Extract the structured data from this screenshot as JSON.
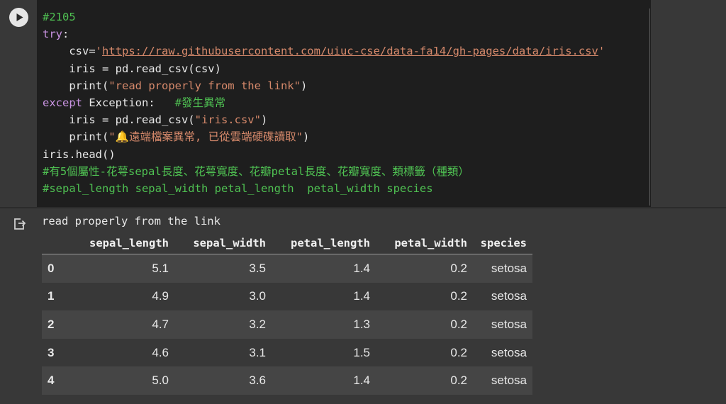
{
  "cell": {
    "run_icon": "play-icon",
    "code_lines": [
      [
        {
          "t": "comment",
          "v": "#2105"
        }
      ],
      [
        {
          "t": "kw",
          "v": "try"
        },
        {
          "t": "plain",
          "v": ":"
        }
      ],
      [
        {
          "t": "plain",
          "v": "    csv="
        },
        {
          "t": "str",
          "v": "'"
        },
        {
          "t": "url",
          "v": "https://raw.githubusercontent.com/uiuc-cse/data-fa14/gh-pages/data/iris.csv"
        },
        {
          "t": "str",
          "v": "'"
        }
      ],
      [
        {
          "t": "plain",
          "v": "    iris = pd.read_csv(csv)"
        }
      ],
      [
        {
          "t": "plain",
          "v": "    print("
        },
        {
          "t": "str",
          "v": "\"read properly from the link\""
        },
        {
          "t": "plain",
          "v": ")"
        }
      ],
      [
        {
          "t": "kw",
          "v": "except"
        },
        {
          "t": "plain",
          "v": " Exception:   "
        },
        {
          "t": "comment",
          "v": "#發生異常"
        }
      ],
      [
        {
          "t": "plain",
          "v": "    iris = pd.read_csv("
        },
        {
          "t": "str",
          "v": "\"iris.csv\""
        },
        {
          "t": "plain",
          "v": ")"
        }
      ],
      [
        {
          "t": "plain",
          "v": "    print("
        },
        {
          "t": "str",
          "v": "\"🔔遠端檔案異常, 已從雲端硬碟讀取\""
        },
        {
          "t": "plain",
          "v": ")"
        }
      ],
      [
        {
          "t": "plain",
          "v": "iris.head()"
        }
      ],
      [
        {
          "t": "comment",
          "v": "#有5個屬性-花萼sepal長度、花萼寬度、花瓣petal長度、花瓣寬度、類標籤（種類）"
        }
      ],
      [
        {
          "t": "comment",
          "v": "#sepal_length sepal_width petal_length  petal_width species"
        }
      ]
    ]
  },
  "output": {
    "icon": "output-redirect-icon",
    "stdout": "read properly from the link",
    "table": {
      "columns": [
        "sepal_length",
        "sepal_width",
        "petal_length",
        "petal_width",
        "species"
      ],
      "rows": [
        {
          "index": "0",
          "values": [
            "5.1",
            "3.5",
            "1.4",
            "0.2",
            "setosa"
          ]
        },
        {
          "index": "1",
          "values": [
            "4.9",
            "3.0",
            "1.4",
            "0.2",
            "setosa"
          ]
        },
        {
          "index": "2",
          "values": [
            "4.7",
            "3.2",
            "1.3",
            "0.2",
            "setosa"
          ]
        },
        {
          "index": "3",
          "values": [
            "4.6",
            "3.1",
            "1.5",
            "0.2",
            "setosa"
          ]
        },
        {
          "index": "4",
          "values": [
            "5.0",
            "3.6",
            "1.4",
            "0.2",
            "setosa"
          ]
        }
      ]
    }
  },
  "colors": {
    "background": "#383838",
    "editor_background": "#1e1e1e",
    "comment": "#4fc152",
    "keyword": "#c792e0",
    "string": "#d6896b",
    "text": "#e8e8e8",
    "row_stripe": "#454545"
  }
}
